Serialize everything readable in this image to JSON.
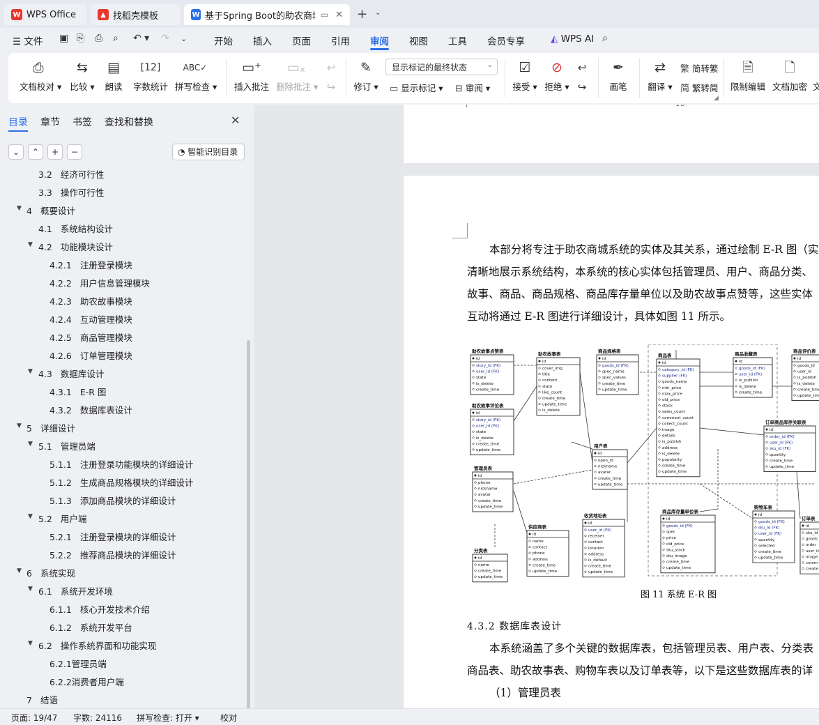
{
  "tabs": [
    {
      "label": "WPS Office"
    },
    {
      "label": "找稻壳模板"
    },
    {
      "label": "基于Spring Boot的助农商城的"
    }
  ],
  "menu": {
    "file": "文件",
    "items": [
      "开始",
      "插入",
      "页面",
      "引用",
      "审阅",
      "视图",
      "工具",
      "会员专享"
    ],
    "active": "审阅",
    "wps_ai": "WPS AI"
  },
  "ribbon": {
    "doc_check": "文档校对",
    "compare": "比较",
    "read_aloud": "朗读",
    "word_count": "字数统计",
    "spell_check": "拼写检查",
    "insert_comment": "插入批注",
    "delete_comment": "删除批注",
    "revise": "修订",
    "markup_mode": "显示标记的最终状态",
    "show_markup": "显示标记",
    "review": "审阅",
    "accept": "接受",
    "reject": "拒绝",
    "pen": "画笔",
    "translate": "翻译",
    "to_traditional": "简转繁",
    "to_simplified": "繁转简",
    "restrict_edit": "限制编辑",
    "doc_encrypt": "文档加密",
    "more": "文"
  },
  "sidebar": {
    "tabs": [
      "目录",
      "章节",
      "书签",
      "查找和替换"
    ],
    "smart_toc": "智能识别目录",
    "toc": [
      {
        "num": "3.2",
        "text": "经济可行性",
        "level": 2
      },
      {
        "num": "3.3",
        "text": "操作可行性",
        "level": 2
      },
      {
        "num": "4",
        "text": "概要设计",
        "level": 1
      },
      {
        "num": "4.1",
        "text": "系统结构设计",
        "level": 2
      },
      {
        "num": "4.2",
        "text": "功能模块设计",
        "level": 2
      },
      {
        "num": "4.2.1",
        "text": "注册登录模块",
        "level": 3
      },
      {
        "num": "4.2.2",
        "text": "用户信息管理模块",
        "level": 3
      },
      {
        "num": "4.2.3",
        "text": "助农故事模块",
        "level": 3
      },
      {
        "num": "4.2.4",
        "text": "互动管理模块",
        "level": 3
      },
      {
        "num": "4.2.5",
        "text": "商品管理模块",
        "level": 3
      },
      {
        "num": "4.2.6",
        "text": "订单管理模块",
        "level": 3
      },
      {
        "num": "4.3",
        "text": "数据库设计",
        "level": 2
      },
      {
        "num": "4.3.1",
        "text": "E-R 图",
        "level": 3
      },
      {
        "num": "4.3.2",
        "text": "数据库表设计",
        "level": 3
      },
      {
        "num": "5",
        "text": "详细设计",
        "level": 1
      },
      {
        "num": "5.1",
        "text": "管理员端",
        "level": 2
      },
      {
        "num": "5.1.1",
        "text": "注册登录功能模块的详细设计",
        "level": 3
      },
      {
        "num": "5.1.2",
        "text": "生成商品规格模块的详细设计",
        "level": 3
      },
      {
        "num": "5.1.3",
        "text": "添加商品模块的详细设计",
        "level": 3
      },
      {
        "num": "5.2",
        "text": "用户端",
        "level": 2
      },
      {
        "num": "5.2.1",
        "text": "注册登录模块的详细设计",
        "level": 3
      },
      {
        "num": "5.2.2",
        "text": "推荐商品模块的详细设计",
        "level": 3
      },
      {
        "num": "6",
        "text": "系统实现",
        "level": 1
      },
      {
        "num": "6.1",
        "text": "系统开发环境",
        "level": 2
      },
      {
        "num": "6.1.1",
        "text": "核心开发技术介绍",
        "level": 3
      },
      {
        "num": "6.1.2",
        "text": "系统开发平台",
        "level": 3
      },
      {
        "num": "6.2",
        "text": "操作系统界面和功能实现",
        "level": 2
      },
      {
        "num": "",
        "text": "6.2.1管理员端",
        "level": 3
      },
      {
        "num": "",
        "text": "6.2.2消费者用户端",
        "level": 3
      },
      {
        "num": "7",
        "text": "结语",
        "level": 1
      }
    ]
  },
  "document": {
    "page_number": "15",
    "para1": [
      "本部分将专注于助农商城系统的实体及其关系，通过绘制 E-R 图（实",
      "清晰地展示系统结构，本系统的核心实体包括管理员、用户、商品分类、",
      "故事、商品、商品规格、商品库存量单位以及助农故事点赞等，这些实体",
      "互动将通过 E-R 图进行详细设计，具体如图 11 所示。"
    ],
    "figure_caption": "图 11  系统 E-R 图",
    "section_heading": "4.3.2   数据库表设计",
    "para2": [
      "本系统涵盖了多个关键的数据库表，包括管理员表、用户表、分类表",
      "商品表、助农故事表、购物车表以及订单表等，以下是这些数据库表的详"
    ],
    "para3": "（1）管理员表"
  },
  "er_tables": [
    {
      "title": "助农故事点赞表",
      "fields": [
        "id",
        "story_id (FK)",
        "user_id (FK)",
        "state",
        "is_delete",
        "create_time"
      ]
    },
    {
      "title": "助农故事表",
      "fields": [
        "id",
        "cover_img",
        "title",
        "content",
        "state",
        "like_count",
        "create_time",
        "update_time",
        "is_delete"
      ]
    },
    {
      "title": "商品规格表",
      "fields": [
        "id",
        "goods_id (FK)",
        "spec_name",
        "spec_values",
        "create_time",
        "update_time"
      ]
    },
    {
      "title": "商品表",
      "fields": [
        "id",
        "category_id (FK)",
        "supplier (FK)",
        "goods_name",
        "min_price",
        "max_price",
        "old_price",
        "stock",
        "sales_count",
        "comment_count",
        "collect_count",
        "image",
        "details",
        "is_publish",
        "address",
        "is_delete",
        "popularity",
        "create_time",
        "update_time"
      ]
    },
    {
      "title": "商品收藏表",
      "fields": [
        "id",
        "goods_id (FK)",
        "user_id (FK)",
        "is_publish",
        "is_delete",
        "create_time"
      ]
    },
    {
      "title": "商品评价表",
      "fields": [
        "id",
        "goods_id",
        "user_id",
        "is_publish",
        "is_delete",
        "create_time",
        "update_time"
      ]
    },
    {
      "title": "助农故事评论表",
      "fields": [
        "id",
        "story_id (FK)",
        "user_id (FK)",
        "state",
        "is_delete",
        "create_time",
        "update_time"
      ]
    },
    {
      "title": "用户表",
      "fields": [
        "id",
        "open_id",
        "nickname",
        "avatar",
        "create_time",
        "update_time"
      ]
    },
    {
      "title": "订单商品库存关联表",
      "fields": [
        "id",
        "order_id (FK)",
        "user_id (FK)",
        "sku_id (FK)",
        "quantity",
        "create_time",
        "update_time"
      ]
    },
    {
      "title": "管理员表",
      "fields": [
        "id",
        "phone",
        "nickname",
        "avatar",
        "create_time",
        "update_time"
      ]
    },
    {
      "title": "收货地址表",
      "fields": [
        "id",
        "user_id (FK)",
        "receiver",
        "contact",
        "location",
        "address",
        "is_default",
        "create_time",
        "update_time"
      ]
    },
    {
      "title": "商品库存量单位表",
      "fields": [
        "id",
        "goods_id (FK)",
        "spec",
        "price",
        "old_price",
        "sku_stock",
        "sku_image",
        "create_time",
        "update_time"
      ]
    },
    {
      "title": "购物车表",
      "fields": [
        "id",
        "goods_id (FK)",
        "sku_id (FK)",
        "user_id (FK)",
        "quantity",
        "selected",
        "create_time",
        "update_time"
      ]
    },
    {
      "title": "订单表",
      "fields": [
        "id",
        "sku_id",
        "goods",
        "order",
        "user_id",
        "image",
        "comm",
        "create"
      ]
    },
    {
      "title": "供应商表",
      "fields": [
        "id",
        "name",
        "contact",
        "phone",
        "address",
        "create_time",
        "update_time"
      ]
    },
    {
      "title": "分类表",
      "fields": [
        "id",
        "name",
        "create_time",
        "update_time"
      ]
    }
  ],
  "statusbar": {
    "page": "页面: 19/47",
    "words": "字数: 24116",
    "spell": "拼写检查: 打开",
    "proof": "校对"
  }
}
